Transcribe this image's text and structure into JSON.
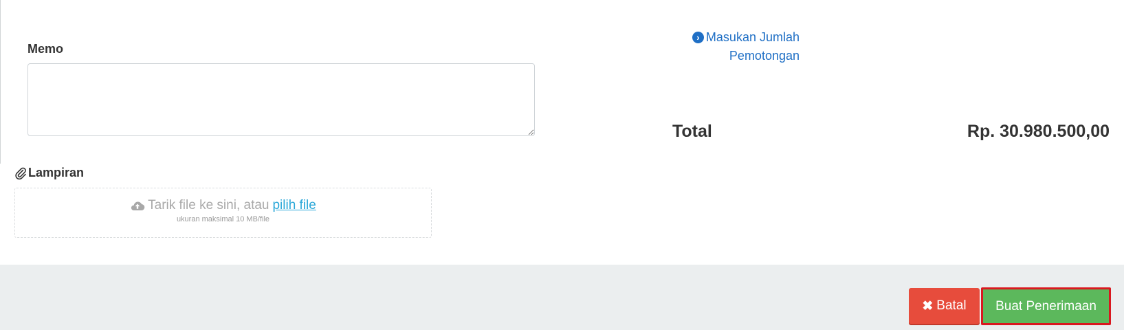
{
  "memo": {
    "label": "Memo",
    "value": "",
    "placeholder": ""
  },
  "deduction": {
    "link_line1": "Masukan Jumlah",
    "link_line2": "Pemotongan",
    "icon": "chevron-circle-right-icon"
  },
  "summary": {
    "total_label": "Total",
    "total_value": "Rp. 30.980.500,00"
  },
  "attachment": {
    "label": "Lampiran",
    "icon": "paperclip-icon",
    "dropzone_text": "Tarik file ke sini, atau",
    "pick_file_link": "pilih file",
    "size_hint": "ukuran maksimal 10 MB/file",
    "dropzone_icon": "cloud-upload-icon"
  },
  "footer": {
    "cancel_label": "Batal",
    "cancel_icon": "close-icon",
    "submit_label": "Buat Penerimaan"
  },
  "colors": {
    "link": "#1f6fc5",
    "cancel": "#e74c3c",
    "submit": "#5cb85c",
    "submit_focus_border": "#d9181f",
    "footer_bg": "#ebeeef",
    "pick_link": "#2aa7d8"
  }
}
